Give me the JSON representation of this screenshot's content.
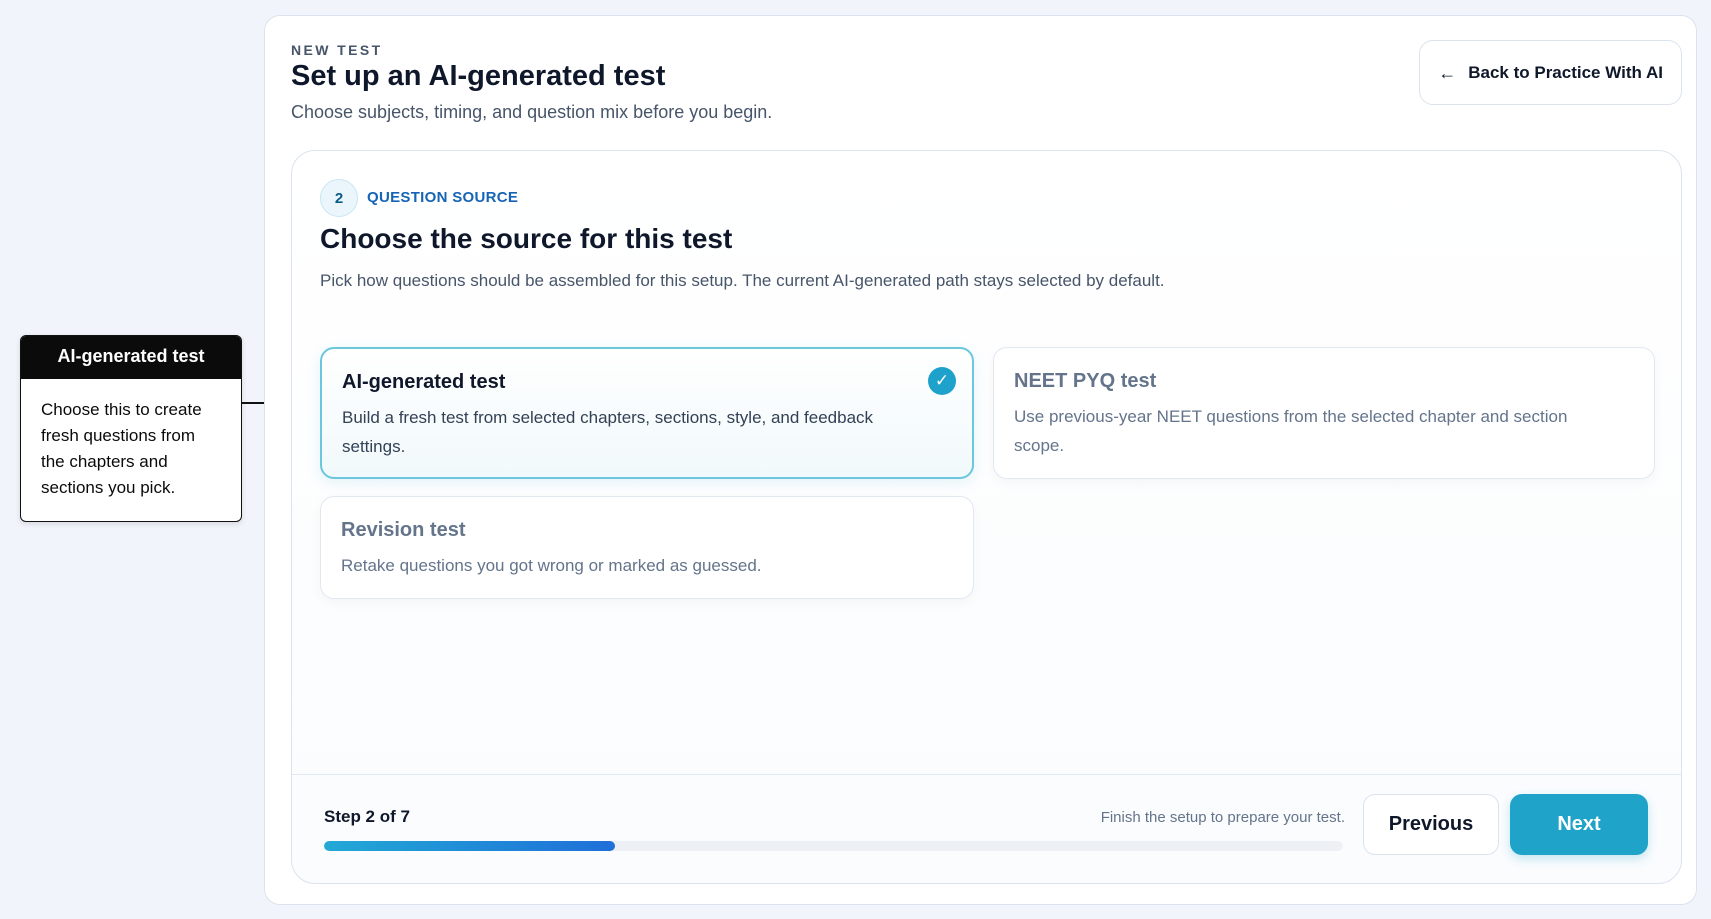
{
  "callout": {
    "title": "AI-generated test",
    "body": "Choose this to create fresh questions from the chapters and sections you pick."
  },
  "header": {
    "eyebrow": "NEW TEST",
    "title": "Set up an AI-generated test",
    "subtitle": "Choose subjects, timing, and question mix before you begin.",
    "back_label": "Back to Practice With AI",
    "back_icon": "arrow-left-icon"
  },
  "step": {
    "number": "2",
    "label": "QUESTION SOURCE",
    "title": "Choose the source for this test",
    "description": "Pick how questions should be assembled for this setup. The current AI-generated path stays selected by default."
  },
  "options": [
    {
      "title": "AI-generated test",
      "description": "Build a fresh test from selected chapters, sections, style, and feedback settings.",
      "selected": true
    },
    {
      "title": "NEET PYQ test",
      "description": "Use previous-year NEET questions from the selected chapter and section scope.",
      "selected": false
    },
    {
      "title": "Revision test",
      "description": "Retake questions you got wrong or marked as guessed.",
      "selected": false
    }
  ],
  "footer": {
    "step_count": "Step 2 of 7",
    "hint": "Finish the setup to prepare your test.",
    "progress": 0.2857,
    "previous_label": "Previous",
    "next_label": "Next"
  },
  "colors": {
    "accent": "#1fa3c8",
    "selected_border": "#6cc7dd",
    "link_blue": "#1664b5"
  }
}
